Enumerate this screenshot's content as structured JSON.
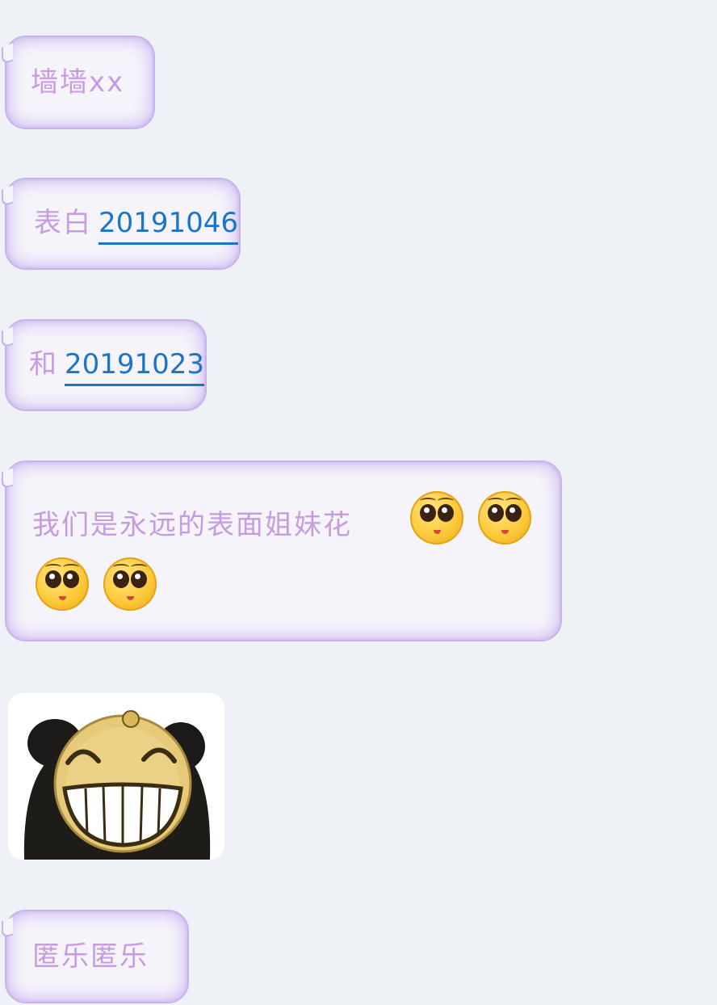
{
  "messages": [
    {
      "text": "墙墙xx"
    },
    {
      "prefix": "表白",
      "link": "20191046"
    },
    {
      "prefix": "和",
      "link": "20191023"
    },
    {
      "text": "我们是永远的表面姐妹花",
      "emoji": [
        "smile-emoji",
        "smile-emoji",
        "smile-emoji",
        "smile-emoji"
      ]
    },
    {
      "sticker": "grinning-panda-sticker"
    },
    {
      "text": "匿乐匿乐"
    }
  ],
  "colors": {
    "background": "#eef2f6",
    "bubble_text": "#c79be0",
    "bubble_border": "#c8b2ea",
    "link": "#1a75c8"
  }
}
